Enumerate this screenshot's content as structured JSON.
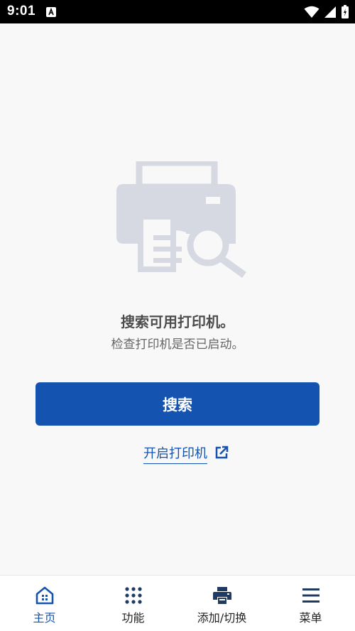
{
  "status": {
    "time": "9:01"
  },
  "empty_state": {
    "title": "搜索可用打印机。",
    "subtitle": "检查打印机是否已启动。"
  },
  "actions": {
    "search_label": "搜索",
    "open_printer_label": "开启打印机"
  },
  "bottom_nav": {
    "items": [
      {
        "label": "主页",
        "icon": "home-icon",
        "active": true
      },
      {
        "label": "功能",
        "icon": "grid-icon",
        "active": false
      },
      {
        "label": "添加/切换",
        "icon": "printer-icon",
        "active": false
      },
      {
        "label": "菜单",
        "icon": "menu-icon",
        "active": false
      }
    ]
  },
  "colors": {
    "primary": "#1453b0",
    "illustration": "#d6d8e2",
    "background": "#f8f8f9"
  }
}
